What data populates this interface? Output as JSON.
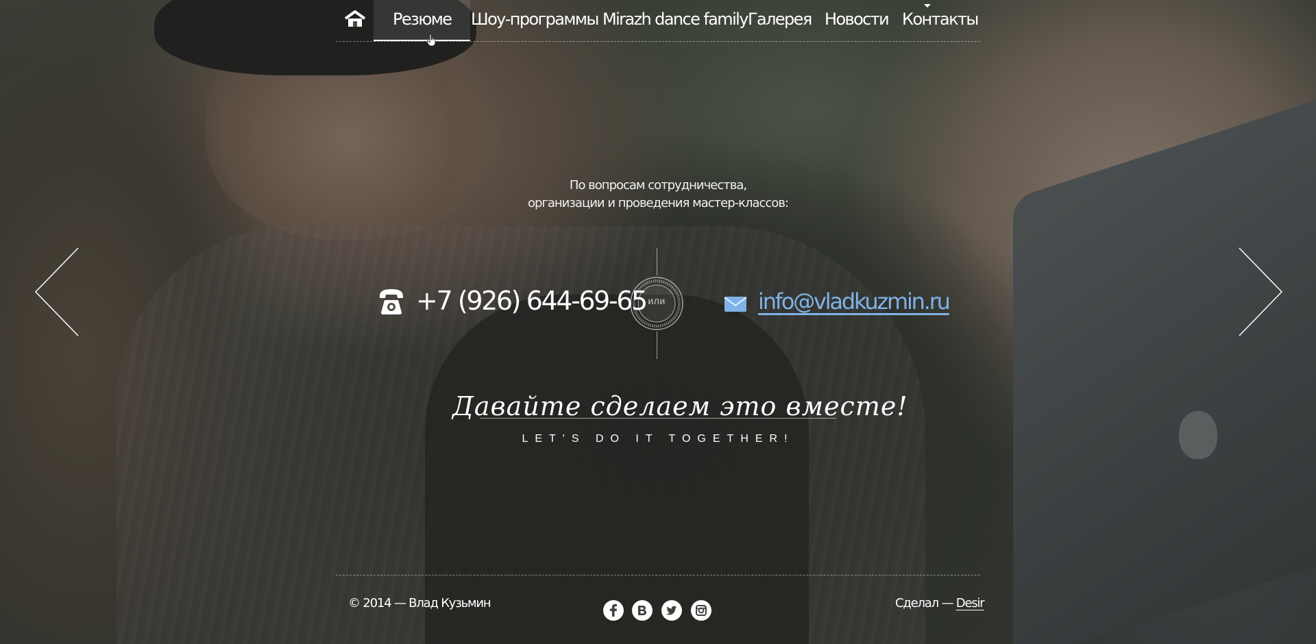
{
  "nav": {
    "items": [
      {
        "label": "Резюме"
      },
      {
        "label": "Шоу-программы"
      },
      {
        "label": "Mirazh dance family"
      },
      {
        "label": "Галерея"
      },
      {
        "label": "Новости"
      },
      {
        "label": "Контакты"
      }
    ],
    "active": "Резюме",
    "home_icon": "home-icon"
  },
  "contact": {
    "lead_line1": "По вопросам сотрудничества,",
    "lead_line2": "организации и проведения мастер-классов:",
    "phone": "+7 (926) 644-69-65",
    "phone_icon": "phone-icon",
    "or_label": "или",
    "email": "info@vladkuzmin.ru",
    "email_icon": "mail-icon"
  },
  "slogan": {
    "script": "Давайте сделаем это вместе!",
    "subtitle": "LET'S DO IT TOGETHER!"
  },
  "slider": {
    "prev_icon": "chevron-left-icon",
    "next_icon": "chevron-right-icon"
  },
  "footer": {
    "copyright": "© 2014 — Влад Кузьмин",
    "social": [
      "facebook-icon",
      "vkontakte-icon",
      "twitter-icon",
      "instagram-icon"
    ],
    "made_prefix": "Сделал —",
    "made_link": "Desir"
  },
  "colors": {
    "link": "#7fb3e8",
    "text": "#ffffff",
    "overlay": "#23261f"
  }
}
